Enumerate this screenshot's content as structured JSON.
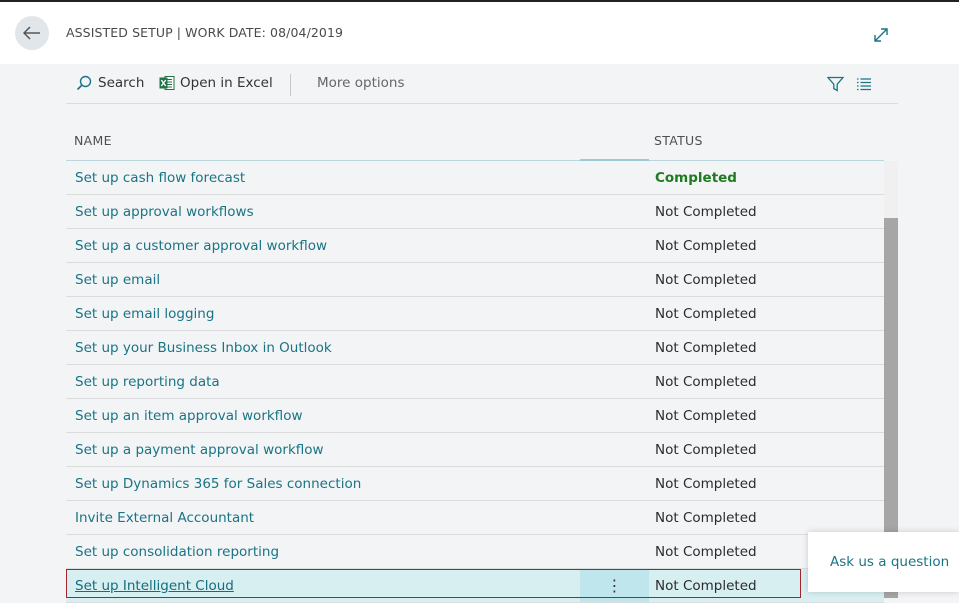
{
  "header": {
    "title": "ASSISTED SETUP | WORK DATE: 08/04/2019"
  },
  "toolbar": {
    "search_label": "Search",
    "excel_label": "Open in Excel",
    "more_label": "More options"
  },
  "table": {
    "columns": [
      "NAME",
      "STATUS"
    ],
    "rows": [
      {
        "name": "Set up cash flow forecast",
        "status": "Completed"
      },
      {
        "name": "Set up approval workflows",
        "status": "Not Completed"
      },
      {
        "name": "Set up a customer approval workflow",
        "status": "Not Completed"
      },
      {
        "name": "Set up email",
        "status": "Not Completed"
      },
      {
        "name": "Set up email logging",
        "status": "Not Completed"
      },
      {
        "name": "Set up your Business Inbox in Outlook",
        "status": "Not Completed"
      },
      {
        "name": "Set up reporting data",
        "status": "Not Completed"
      },
      {
        "name": "Set up an item approval workflow",
        "status": "Not Completed"
      },
      {
        "name": "Set up a payment approval workflow",
        "status": "Not Completed"
      },
      {
        "name": "Set up Dynamics 365 for Sales connection",
        "status": "Not Completed"
      },
      {
        "name": "Invite External Accountant",
        "status": "Not Completed"
      },
      {
        "name": "Set up consolidation reporting",
        "status": "Not Completed"
      },
      {
        "name": "Set up Intelligent Cloud",
        "status": "Not Completed"
      }
    ],
    "row_menu_glyph": "⋮"
  },
  "ask": {
    "label": "Ask us a question"
  },
  "colors": {
    "link": "#1a7484",
    "completed": "#217a21",
    "selected_row": "#d8eff2",
    "selection_outline": "#a4262c"
  }
}
